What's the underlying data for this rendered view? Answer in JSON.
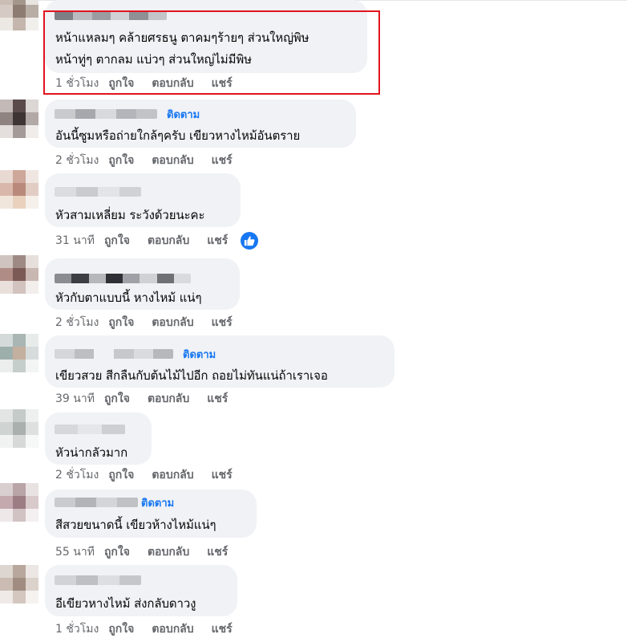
{
  "colors": {
    "bubble": "#f0f2f5",
    "link_blue": "#1877f2",
    "meta_gray": "#65676b",
    "highlight_red": "#e0151f"
  },
  "comments": [
    {
      "text_lines": [
        "หน้าแหลมๆ คล้ายศรธนู ตาคมๆร้ายๆ ส่วนใหญ่พิษ",
        "หน้าทู่ๆ ตากลม แบ่วๆ ส่วนใหญ่ไม่มีพิษ"
      ],
      "time": "1 ชั่วโมง",
      "like": "ถูกใจ",
      "reply": "ตอบกลับ",
      "share": "แชร์"
    },
    {
      "follow": "ติดตาม",
      "text_lines": [
        "อันนี้ซูมหรือถ่ายใกล้ๆครับ เขียวหางไหม้อันตราย"
      ],
      "time": "2 ชั่วโมง",
      "like": "ถูกใจ",
      "reply": "ตอบกลับ",
      "share": "แชร์"
    },
    {
      "text_lines": [
        "หัวสามเหลี่ยม ระวังด้วยนะคะ"
      ],
      "time": "31 นาที",
      "like": "ถูกใจ",
      "reply": "ตอบกลับ",
      "share": "แชร์",
      "reaction_icon": "thumbs-up-icon"
    },
    {
      "text_lines": [
        "หัวกับตาแบบนี้ หางไหม้ แน่ๆ"
      ],
      "time": "2 ชั่วโมง",
      "like": "ถูกใจ",
      "reply": "ตอบกลับ",
      "share": "แชร์"
    },
    {
      "follow": "ติดตาม",
      "text_lines": [
        "เขียวสวย สีกลืนกับต้นไม้ไปอีก ถอยไม่ทันแน่ถ้าเราเจอ"
      ],
      "time": "39 นาที",
      "like": "ถูกใจ",
      "reply": "ตอบกลับ",
      "share": "แชร์"
    },
    {
      "text_lines": [
        "หัวน่ากลัวมาก"
      ],
      "time": "2 ชั่วโมง",
      "like": "ถูกใจ",
      "reply": "ตอบกลับ",
      "share": "แชร์"
    },
    {
      "follow": "ติดตาม",
      "text_lines": [
        "สีสวยขนาดนี้ เขียวห้างไหม้แน่ๆ"
      ],
      "time": "55 นาที",
      "like": "ถูกใจ",
      "reply": "ตอบกลับ",
      "share": "แชร์"
    },
    {
      "text_lines": [
        "อีเขียวหางไหม้ ส่งกลับดาวงู"
      ],
      "time": "1 ชั่วโมง",
      "like": "ถูกใจ",
      "reply": "ตอบกลับ",
      "share": "แชร์"
    }
  ]
}
